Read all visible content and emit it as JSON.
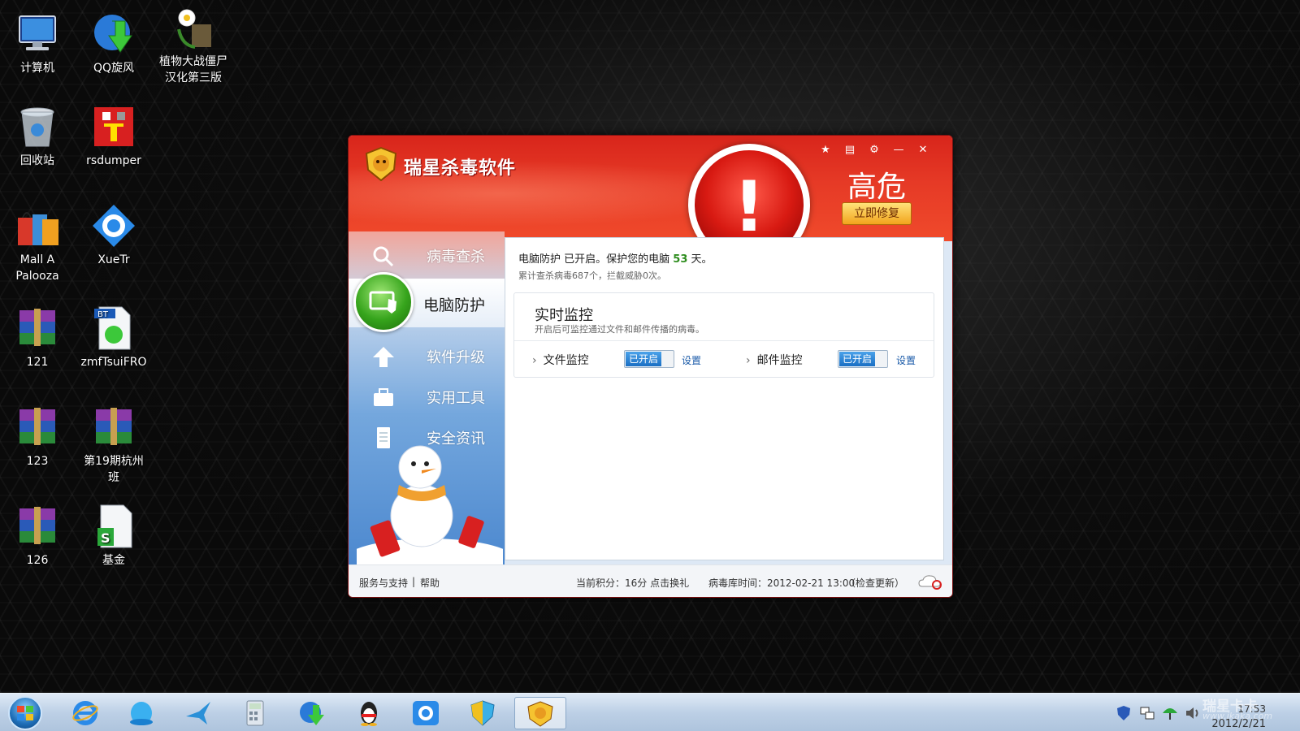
{
  "desktop": {
    "icons": [
      {
        "label": "计算机",
        "icon": "computer-icon"
      },
      {
        "label": "QQ旋风",
        "icon": "qq-whirlwind-icon"
      },
      {
        "label": "植物大战僵尸\n汉化第三版",
        "line1": "植物大战僵尸",
        "line2": "汉化第三版",
        "icon": "plants-vs-zombies-icon"
      },
      {
        "label": "回收站",
        "icon": "recycle-bin-icon"
      },
      {
        "label": "rsdumper",
        "icon": "rsdumper-icon"
      },
      {
        "label": "Mall A Palooza",
        "line1": "Mall A",
        "line2": "Palooza",
        "icon": "shopping-bags-icon"
      },
      {
        "label": "XueTr",
        "icon": "xuetr-icon"
      },
      {
        "label": "121",
        "icon": "winrar-archive-icon"
      },
      {
        "label": "zmfTsuiFRO",
        "icon": "bt-torrent-file-icon"
      },
      {
        "label": "123",
        "icon": "winrar-archive-icon"
      },
      {
        "label": "第19期杭州班",
        "line1": "第19期杭州",
        "line2": "班",
        "icon": "winrar-archive-icon"
      },
      {
        "label": "126",
        "icon": "winrar-archive-icon"
      },
      {
        "label": "基金",
        "icon": "spreadsheet-file-icon"
      }
    ]
  },
  "window": {
    "title": "瑞星杀毒软件",
    "title_buttons": [
      "skin-icon",
      "menu-icon",
      "settings-icon",
      "minimize-icon",
      "close-icon"
    ],
    "risk_level": "高危",
    "fix_button": "立即修复",
    "nav": [
      {
        "label": "病毒查杀",
        "icon": "magnifier-icon"
      },
      {
        "label": "电脑防护",
        "icon": "monitor-shield-icon",
        "active": true
      },
      {
        "label": "软件升级",
        "icon": "up-arrow-icon"
      },
      {
        "label": "实用工具",
        "icon": "toolbox-icon"
      },
      {
        "label": "安全资讯",
        "icon": "document-icon"
      }
    ],
    "status": {
      "prefix": "电脑防护 已开启。保护您的电脑",
      "days": "53",
      "suffix": "天。",
      "stats": "累计查杀病毒687个，拦截威胁0次。"
    },
    "monitor": {
      "title": "实时监控",
      "description": "开启后可监控通过文件和邮件传播的病毒。",
      "items": [
        {
          "label": "文件监控",
          "state": "已开启",
          "settings": "设置"
        },
        {
          "label": "邮件监控",
          "state": "已开启",
          "settings": "设置"
        }
      ]
    },
    "statusbar": {
      "support": "服务与支持",
      "separator": "|",
      "help": "帮助",
      "points": "当前积分：16分 点击换礼",
      "virus_db": "病毒库时间：2012-02-21 13:00",
      "check_update": "（检查更新）"
    }
  },
  "taskbar": {
    "apps": [
      "internet-explorer-icon",
      "qq-bubble-icon",
      "bird-icon",
      "calculator-icon",
      "qq-whirlwind-icon",
      "qq-penguin-icon",
      "xuetr-icon",
      "shield-icon",
      "rising-lion-icon"
    ],
    "tray_icons": [
      "shield-tray-icon",
      "network-icon",
      "umbrella-icon",
      "volume-icon"
    ],
    "time": "17:53",
    "date": "2012/2/21"
  },
  "watermark": {
    "line1": "瑞星卡卡",
    "line2": "www.ikaka.com"
  },
  "colors": {
    "header_red": "#e63a26",
    "active_green": "#36a41c",
    "toggle_blue": "#1a6fc4",
    "link_blue": "#1a5aa8"
  }
}
